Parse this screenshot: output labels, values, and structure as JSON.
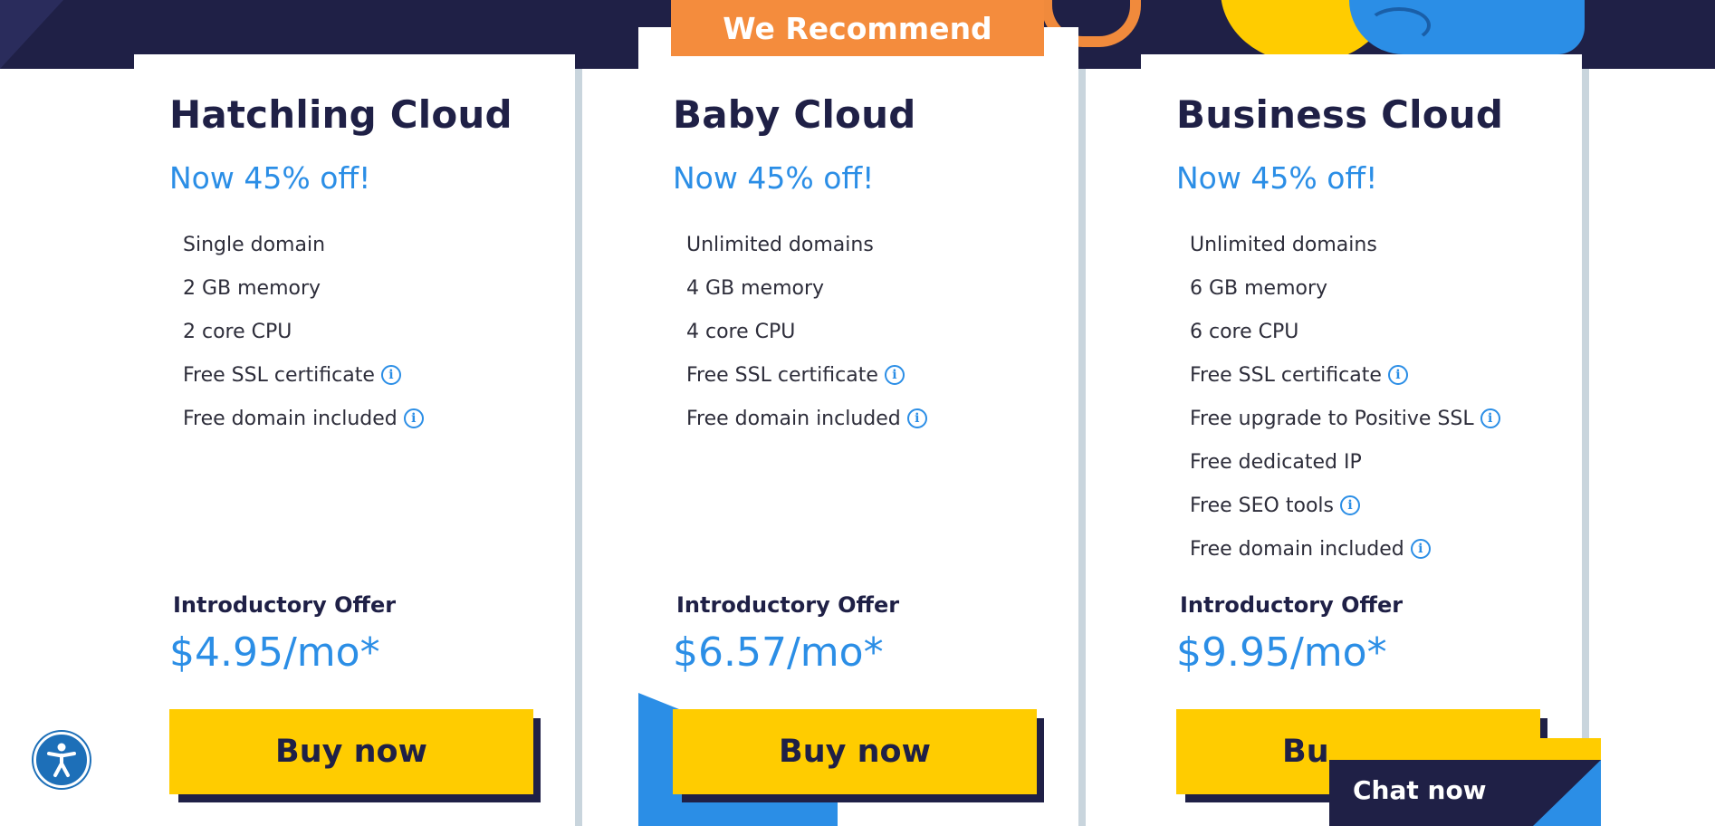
{
  "recommend_tag": "We Recommend",
  "plans": [
    {
      "name": "Hatchling Cloud",
      "discount": "Now 45% off!",
      "features": [
        {
          "text": "Single domain",
          "info": false
        },
        {
          "text": "2 GB memory",
          "info": false
        },
        {
          "text": "2 core CPU",
          "info": false
        },
        {
          "text": "Free SSL certificate",
          "info": true
        },
        {
          "text": "Free domain included",
          "info": true
        }
      ],
      "offer_label": "Introductory Offer",
      "price": "$4.95/mo*",
      "cta": "Buy now"
    },
    {
      "name": "Baby Cloud",
      "discount": "Now 45% off!",
      "features": [
        {
          "text": "Unlimited domains",
          "info": false
        },
        {
          "text": "4 GB memory",
          "info": false
        },
        {
          "text": "4 core CPU",
          "info": false
        },
        {
          "text": "Free SSL certificate",
          "info": true
        },
        {
          "text": "Free domain included",
          "info": true
        }
      ],
      "offer_label": "Introductory Offer",
      "price": "$6.57/mo*",
      "cta": "Buy now"
    },
    {
      "name": "Business Cloud",
      "discount": "Now 45% off!",
      "features": [
        {
          "text": "Unlimited domains",
          "info": false
        },
        {
          "text": "6 GB memory",
          "info": false
        },
        {
          "text": "6 core CPU",
          "info": false
        },
        {
          "text": "Free SSL certificate",
          "info": true
        },
        {
          "text": "Free upgrade to Positive SSL",
          "info": true
        },
        {
          "text": "Free dedicated IP",
          "info": false
        },
        {
          "text": "Free SEO tools",
          "info": true
        },
        {
          "text": "Free domain included",
          "info": true
        }
      ],
      "offer_label": "Introductory Offer",
      "price": "$9.95/mo*",
      "cta": "Buy now"
    }
  ],
  "chat": {
    "label": "Chat now"
  },
  "icons": {
    "info": "info-circle-icon",
    "accessibility": "accessibility-person-icon"
  },
  "colors": {
    "navy": "#1f2046",
    "blue": "#2b8ee6",
    "yellow": "#ffcc00",
    "orange": "#f48c3d",
    "separator": "#c9d5dd"
  }
}
